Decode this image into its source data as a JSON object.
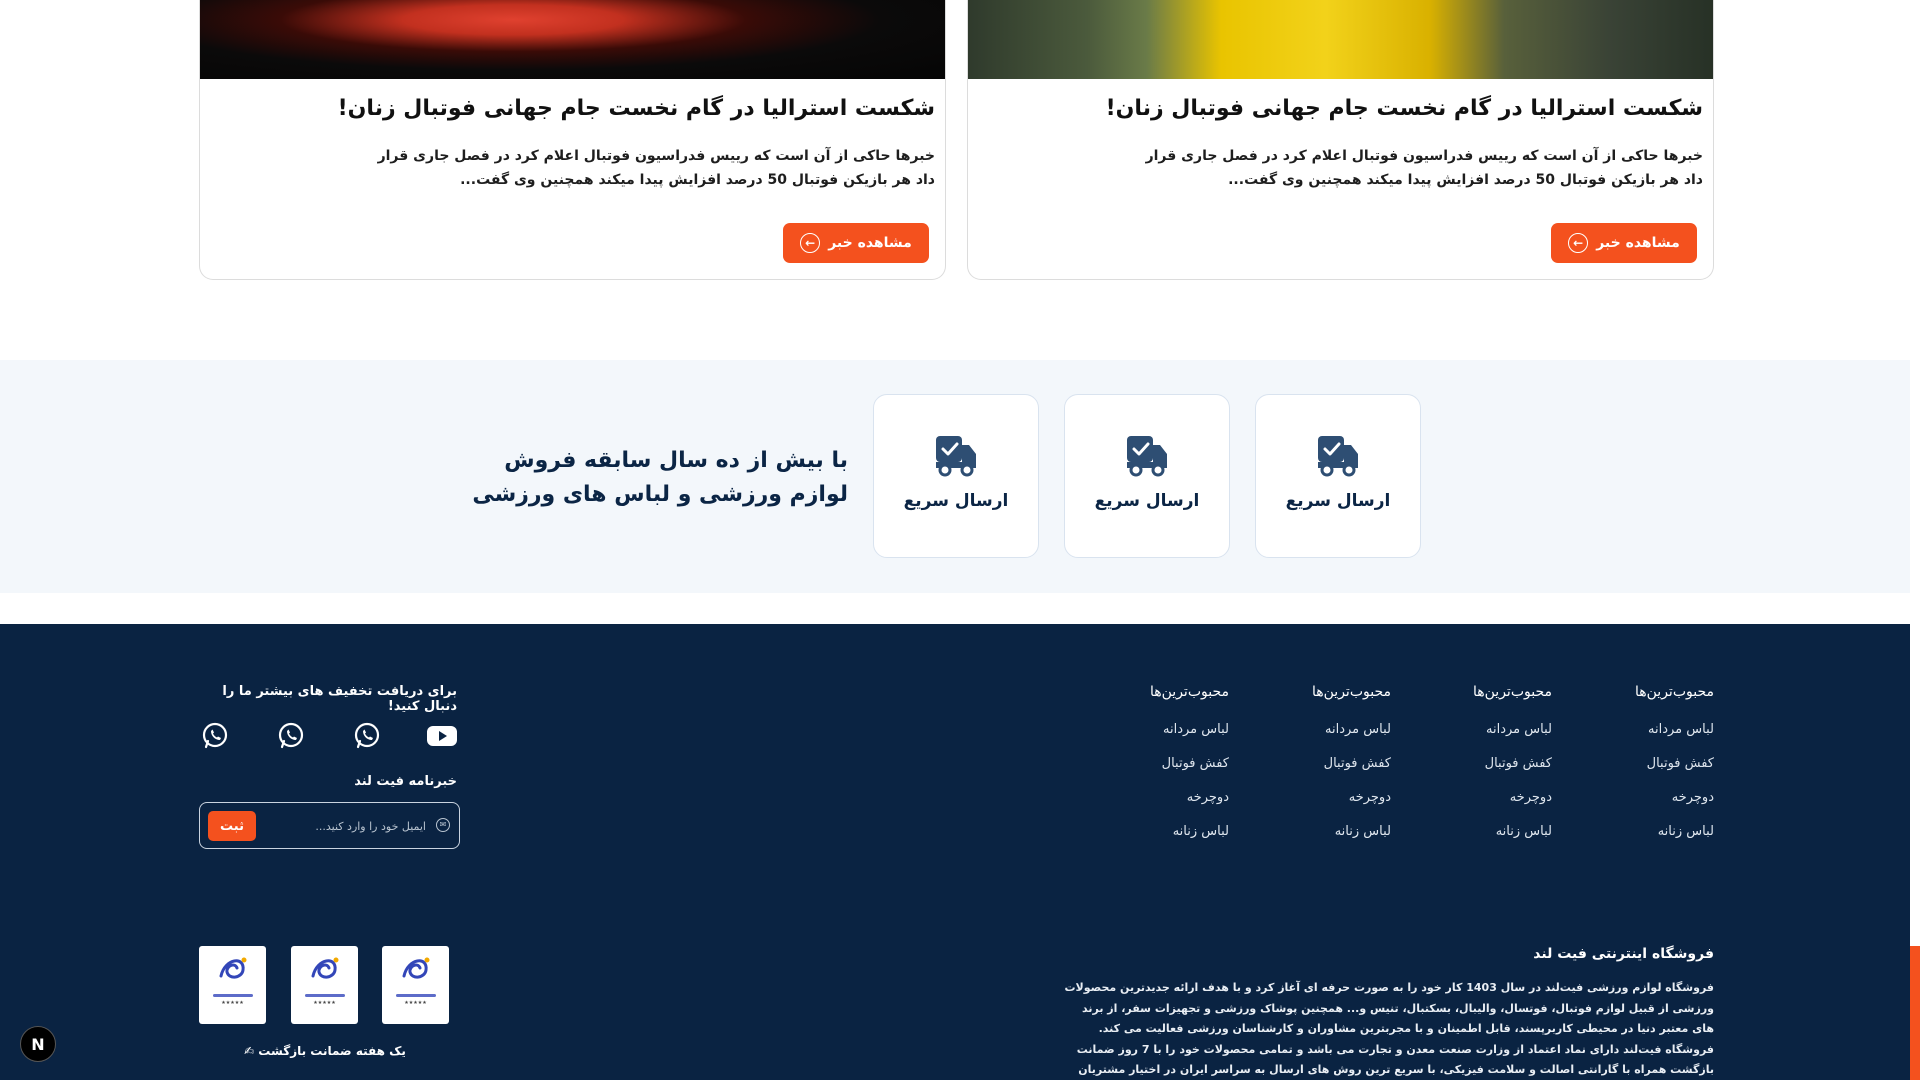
{
  "news": [
    {
      "title": "شکست استرالیا در گام نخست جام جهانی فوتبال زنان!",
      "excerpt": "خبرها حاکی از آن است که رییس فدراسیون فوتبال اعلام کرد در فصل جاری قرار داد هر بازیکن فوتبال 50 درصد افزایش پیدا میکند همچنین وی گفت...",
      "button": "مشاهده خبر"
    },
    {
      "title": "شکست استرالیا در گام نخست جام جهانی فوتبال زنان!",
      "excerpt": "خبرها حاکی از آن است که رییس فدراسیون فوتبال اعلام کرد در فصل جاری قرار داد هر بازیکن فوتبال 50 درصد افزایش پیدا میکند همچنین وی گفت...",
      "button": "مشاهده خبر"
    }
  ],
  "features": {
    "headline": "با بیش از ده سال سابقه فروش لوازم ورزشی و لباس های ورزشی",
    "items": [
      {
        "label": "ارسال سریع",
        "icon": "delivery-truck-icon"
      },
      {
        "label": "ارسال سریع",
        "icon": "delivery-truck-icon"
      },
      {
        "label": "ارسال سریع",
        "icon": "delivery-truck-icon"
      }
    ],
    "icon_color": "#2e4e73"
  },
  "footer": {
    "columns": [
      {
        "heading": "محبوب‌ترین‌ها",
        "links": [
          "لباس مردانه",
          "کفش فوتبال",
          "دوچرخه",
          "لباس زنانه"
        ]
      },
      {
        "heading": "محبوب‌ترین‌ها",
        "links": [
          "لباس مردانه",
          "کفش فوتبال",
          "دوچرخه",
          "لباس زنانه"
        ]
      },
      {
        "heading": "محبوب‌ترین‌ها",
        "links": [
          "لباس مردانه",
          "کفش فوتبال",
          "دوچرخه",
          "لباس زنانه"
        ]
      },
      {
        "heading": "محبوب‌ترین‌ها",
        "links": [
          "لباس مردانه",
          "کفش فوتبال",
          "دوچرخه",
          "لباس زنانه"
        ]
      }
    ],
    "promo_text": "برای دریافت تخفیف های بیشتر ما را دنبال کنید!",
    "socials": [
      "youtube-icon",
      "whatsapp-icon",
      "whatsapp-icon",
      "whatsapp-icon"
    ],
    "newsletter": {
      "title": "خبرنامه فیت لند",
      "placeholder": "ایمیل خود را وارد کنید...",
      "submit": "ثبت"
    },
    "badges": [
      "enamad-badge",
      "enamad-badge",
      "enamad-badge"
    ],
    "guarantee": "یک هفته ضمانت بازگشت ✍",
    "about_title": "فروشگاه اینترنتی فیت لند",
    "about_text": "فروشگاه لوازم ورزشی فیت‌لند در سال 1403 کار خود را به صورت حرفه ای آغاز کرد و با هدف ارائه جدیدترین محصولات ورزشی از قبیل لوازم فوتبال، فوتسال، والیبال، بسکتبال، تنیس و... همچنین پوشاک ورزشی و تجهیزات سفر، از برند های معتبر دنیا در محیطی کاربرپسند، قابل اطمینان و با مجربترین مشاوران و کارشناسان ورزشی فعالیت می کند. فروشگاه فیت‌لند دارای نماد اعتماد از وزارت صنعت معدن و تجارت می باشد و تمامی محصولات خود را با 7 روز ضمانت بازگشت همراه با گارانتی اصالت و سلامت فیزیکی، با سریع ترین روش های ارسال به سراسر ایران در اختیار مشتریان خود قرار می دهد."
  },
  "floating_button": "N",
  "colors": {
    "accent": "#f4511e",
    "footer_bg": "#0a2342",
    "navy": "#0b2545"
  }
}
